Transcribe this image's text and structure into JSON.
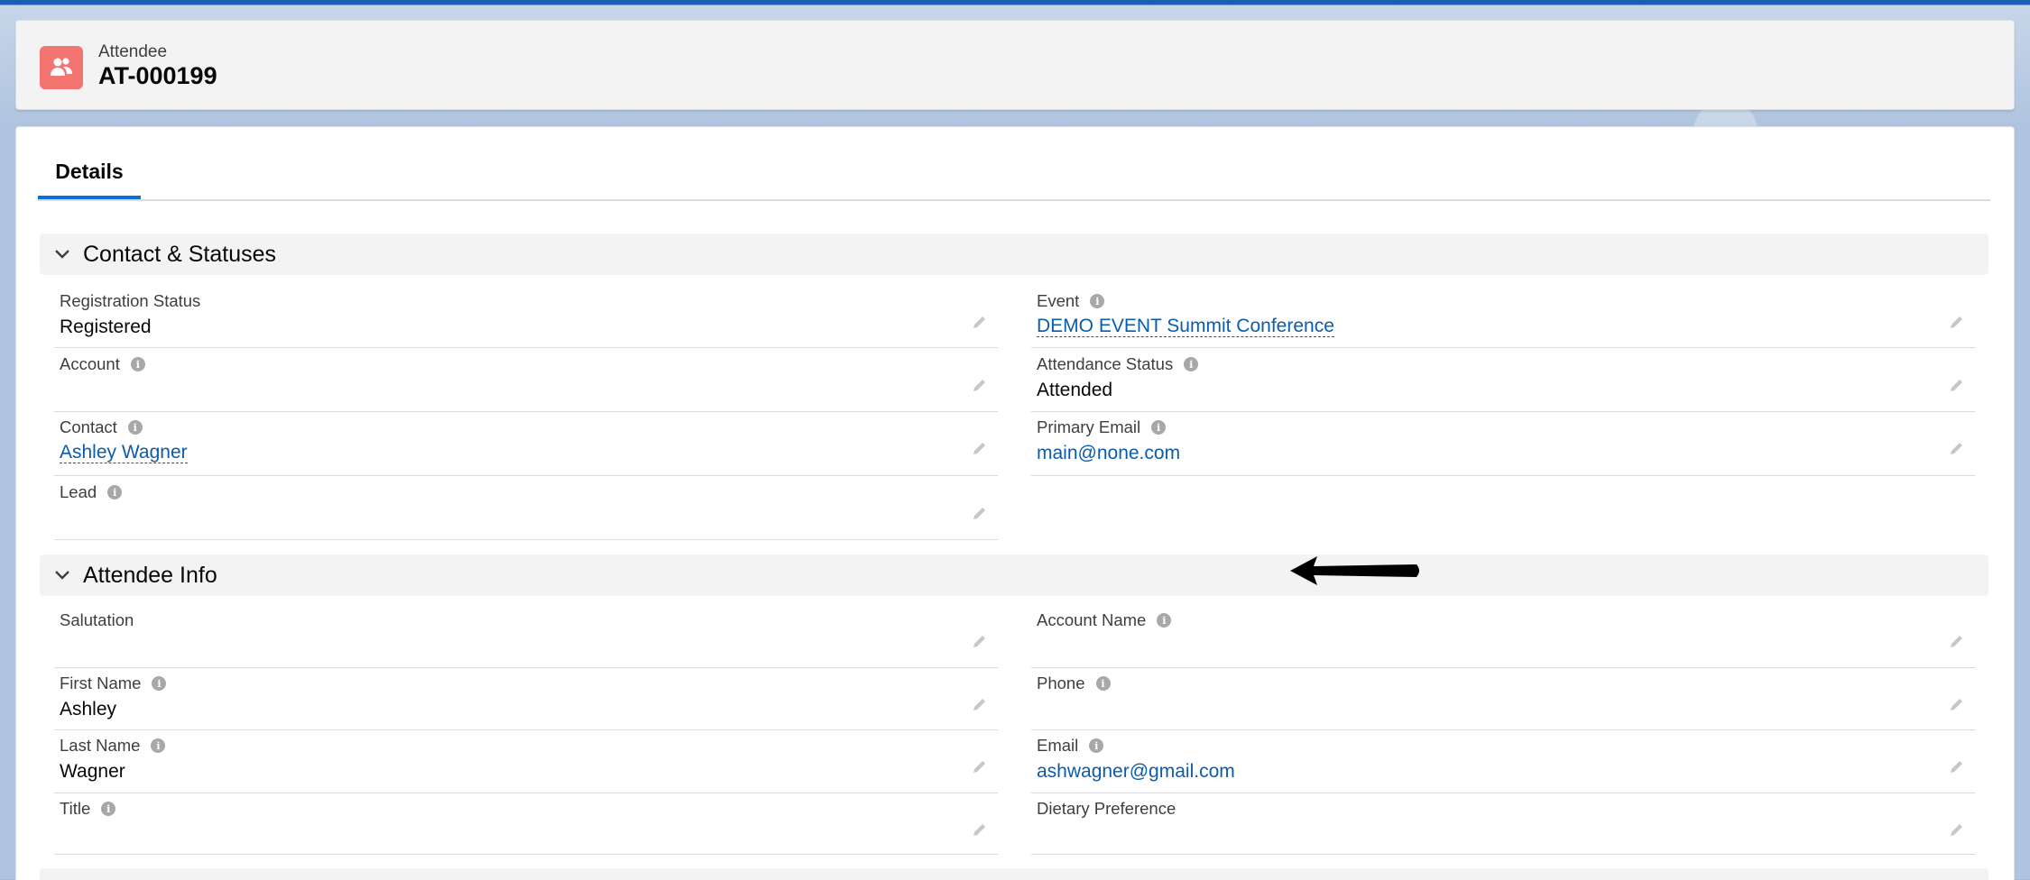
{
  "header": {
    "object_type": "Attendee",
    "record_name": "AT-000199"
  },
  "tabs": [
    {
      "label": "Details"
    }
  ],
  "sections": {
    "contact": {
      "title": "Contact & Statuses",
      "left": [
        {
          "label": "Registration Status",
          "value": "Registered"
        },
        {
          "label": "Account",
          "value": ""
        },
        {
          "label": "Contact",
          "value": "Ashley Wagner"
        },
        {
          "label": "Lead",
          "value": ""
        }
      ],
      "right": [
        {
          "label": "Event",
          "value": "DEMO EVENT Summit Conference"
        },
        {
          "label": "Attendance Status",
          "value": "Attended"
        },
        {
          "label": "Primary Email",
          "value": "main@none.com"
        }
      ]
    },
    "attendee": {
      "title": "Attendee Info",
      "left": [
        {
          "label": "Salutation",
          "value": ""
        },
        {
          "label": "First Name",
          "value": "Ashley"
        },
        {
          "label": "Last Name",
          "value": "Wagner"
        },
        {
          "label": "Title",
          "value": ""
        }
      ],
      "right": [
        {
          "label": "Account Name",
          "value": ""
        },
        {
          "label": "Phone",
          "value": ""
        },
        {
          "label": "Email",
          "value": "ashwagner@gmail.com"
        },
        {
          "label": "Dietary Preference",
          "value": ""
        }
      ]
    }
  },
  "icons": {
    "header": "attendee-icon",
    "info": "info-icon",
    "edit": "pencil-icon",
    "collapse": "chevron-down-icon",
    "annotation": "arrow-left-icon"
  },
  "colors": {
    "brand_blue": "#0b6fd6",
    "link": "#0b5cab",
    "attendee_icon_bg": "#f37471"
  }
}
